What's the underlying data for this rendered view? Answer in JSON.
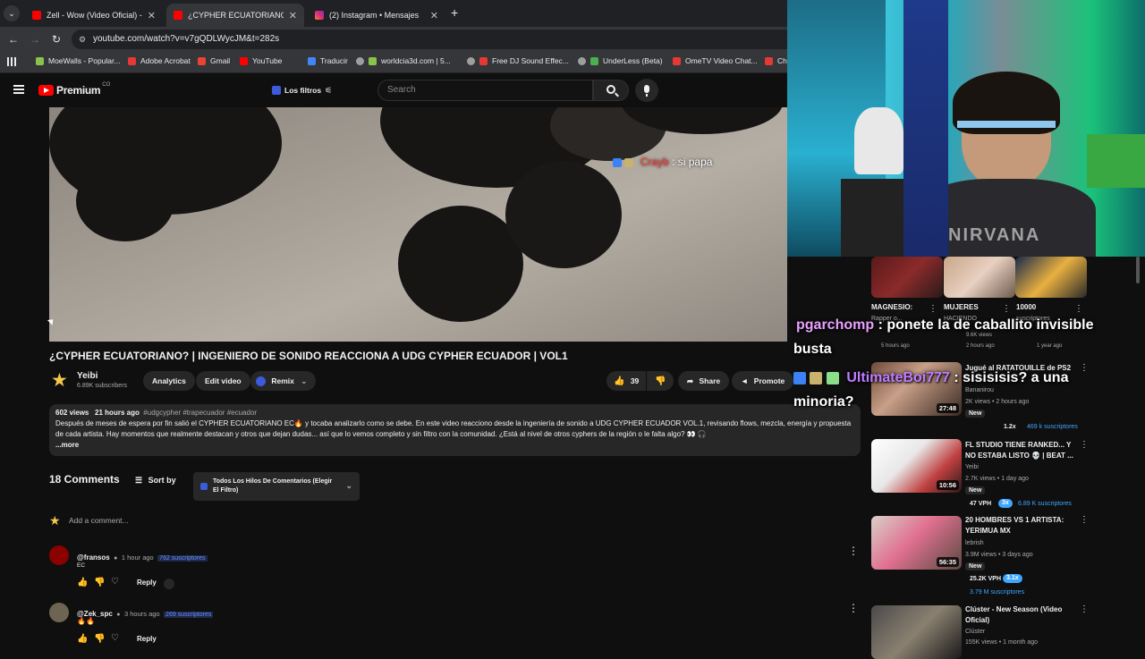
{
  "browser": {
    "tabs": [
      {
        "title": "Zell - Wow (Video Oficial) - You",
        "color": "#ff0000",
        "active": false
      },
      {
        "title": "¿CYPHER ECUATORIANO? | ING",
        "color": "#ff0000",
        "active": true
      },
      {
        "title": "(2) Instagram • Mensajes",
        "color": "#e1306c",
        "active": false
      }
    ],
    "url": "youtube.com/watch?v=v7gQDLWycJM&t=282s",
    "bookmarks": [
      {
        "label": "MoeWalls - Popular...",
        "color": "#8bc34a"
      },
      {
        "label": "Adobe Acrobat",
        "color": "#e53935"
      },
      {
        "label": "Gmail",
        "color": "#ea4335"
      },
      {
        "label": "YouTube",
        "color": "#ff0000"
      },
      {
        "label": "Traducir",
        "color": "#4285f4"
      },
      {
        "label": "worldcia3d.com | 5...",
        "color": "#9e9e9e"
      },
      {
        "label": "Free DJ Sound Effec...",
        "color": "#e53935"
      },
      {
        "label": "UnderLess (Beta)",
        "color": "#4caf50"
      },
      {
        "label": "OmeTV Video Chat...",
        "color": "#e53935"
      },
      {
        "label": "Ch",
        "color": "#e53935"
      }
    ]
  },
  "youtube": {
    "logo": "Premium",
    "logo_super": "CO",
    "filter_chip": "Los filtros",
    "search_placeholder": "Search"
  },
  "video": {
    "chat_user": "Crayb",
    "chat_text": ": si papa",
    "title": "¿CYPHER ECUATORIANO? | INGENIERO DE SONIDO REACCIONA A UDG CYPHER ECUADOR | VOL1",
    "channel": "Yeibi",
    "subscribers": "6.89K subscribers",
    "buttons": {
      "analytics": "Analytics",
      "edit": "Edit video",
      "remix": "Remix",
      "likes": "39",
      "share": "Share",
      "promote": "Promote"
    },
    "views": "602 views",
    "age": "21 hours ago",
    "tags": "#udgcypher #trapecuador #ecuador",
    "description": "Después de meses de espera por fin salió el CYPHER ECUATORIANO EC🔥 y tocaba analizarlo como se debe. En este video reacciono desde la ingeniería de sonido a UDG CYPHER ECUADOR VOL.1, revisando flows, mezcla, energía y propuesta de cada artista. Hay momentos que realmente destacan y otros que dejan dudas... así que lo vemos completo y sin filtro con la comunidad. ¿Está al nivel de otros cyphers de la región o le falta algo? 👀 🎧",
    "more": "...more"
  },
  "comments": {
    "count_label": "18 Comments",
    "sort_label": "Sort by",
    "filter_label_1": "Todos Los Hilos De Comentarios (Elegir",
    "filter_label_2": "El Filtro)",
    "add_placeholder": "Add a comment...",
    "items": [
      {
        "author": "@fransos",
        "time": "1 hour ago",
        "subs": "762 suscriptores",
        "text": "EC",
        "reply": "Reply"
      },
      {
        "author": "@Zek_spc",
        "time": "3 hours ago",
        "subs": "269 suscriptores",
        "text": "🔥🔥",
        "reply": "Reply"
      }
    ]
  },
  "sidebar": {
    "top_row": [
      {
        "title": "MAGNESIO:",
        "sub": "Rapper o...",
        "meta1": "",
        "meta2": "5 hours ago"
      },
      {
        "title": "MUJERES",
        "sub": "HACIENDO",
        "meta1": "9.6K views",
        "meta2": "2 hours ago"
      },
      {
        "title": "10000",
        "sub": "suscriptores",
        "meta1": "",
        "meta2": "1 year ago"
      }
    ],
    "videos": [
      {
        "title": "Jugué al RATATOUILLE de PS2",
        "line2": "",
        "channel": "Bananirou",
        "meta": "2K views • 2 hours ago",
        "duration": "27:48",
        "new": "New",
        "vph": "",
        "mult": "1.2x",
        "subs": "469 k suscriptores"
      },
      {
        "title": "FL STUDIO TIENE RANKED... Y",
        "line2": "NO ESTABA LISTO 💀 | BEAT ...",
        "channel": "Yeibi",
        "meta": "2.7K views • 1 day ago",
        "duration": "10:56",
        "new": "New",
        "vph": "47 VPH",
        "mult": "3x",
        "subs": "6.89 K suscriptores"
      },
      {
        "title": "20 HOMBRES VS 1 ARTISTA:",
        "line2": "YERIMUA MX",
        "channel": "lebrish",
        "meta": "3.9M views • 3 days ago",
        "duration": "56:35",
        "new": "New",
        "vph": "25.2K VPH",
        "mult": "3.1x",
        "subs": "3.79 M suscriptores"
      },
      {
        "title": "Clúster - New Season (Video",
        "line2": "Oficial)",
        "channel": "Clúster",
        "meta": "155K views • 1 month ago",
        "duration": "",
        "new": "",
        "vph": "",
        "mult": "",
        "subs": ""
      }
    ]
  },
  "overlay_chat": {
    "line1_user": "pgarchomp",
    "line1_text": ": ponete la de caballito invisible",
    "line2": "busta",
    "line3_user": "UltimateBoi777",
    "line3_text": ": sisisisis? a una",
    "line4": "minoria?"
  },
  "webcam": {
    "shirt_text": "NIRVANA"
  },
  "colors": {
    "accent": "#ff0000",
    "chat_user1": "#e8a0ff",
    "chat_user2": "#c07cff",
    "chat_user_red": "#ff3b3b",
    "link_blue": "#3ea6ff"
  }
}
